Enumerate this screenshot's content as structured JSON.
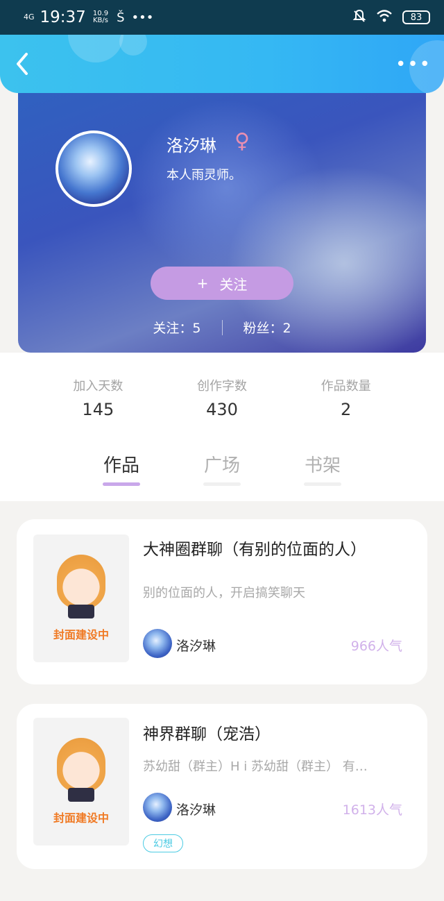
{
  "status_bar": {
    "signal": "4G",
    "time": "19:37",
    "speed_value": "10.9",
    "speed_unit": "KB/s",
    "misc_icon": "Š",
    "dots": "•••",
    "battery": "83"
  },
  "header": {
    "back_icon": "‹",
    "more_icon": "•••"
  },
  "profile": {
    "name": "洛汐琳",
    "gender_icon": "♀",
    "bio": "本人雨灵师。",
    "follow_button_plus": "+",
    "follow_button_label": "关注",
    "following": "关注：5",
    "followers": "粉丝：2"
  },
  "stats": [
    {
      "label": "加入天数",
      "value": "145"
    },
    {
      "label": "创作字数",
      "value": "430"
    },
    {
      "label": "作品数量",
      "value": "2"
    }
  ],
  "tabs": [
    {
      "label": "作品",
      "active": true
    },
    {
      "label": "广场",
      "active": false
    },
    {
      "label": "书架",
      "active": false
    }
  ],
  "works": [
    {
      "cover_text": "封面建设中",
      "title": "大神圈群聊（有别的位面的人）",
      "description": "别的位面的人，开启搞笑聊天",
      "author": "洛汐琳",
      "popularity": "966人气"
    },
    {
      "cover_text": "封面建设中",
      "title": "神界群聊（宠浩）",
      "description": "苏幼甜（群主）H i  苏幼甜（群主） 有…",
      "author": "洛汐琳",
      "popularity": "1613人气",
      "tag": "幻想"
    }
  ]
}
